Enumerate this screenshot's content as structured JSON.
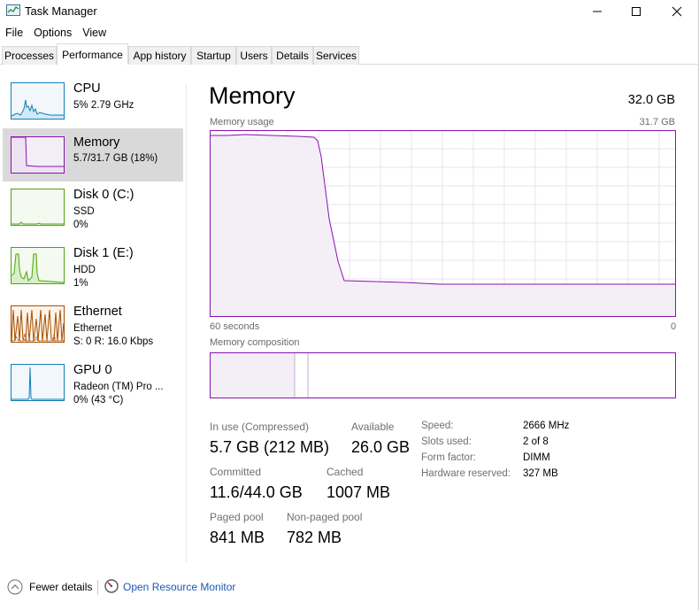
{
  "window": {
    "title": "Task Manager",
    "app_icon": "task-manager-icon",
    "controls": [
      "minimize-icon",
      "maximize-icon",
      "close-icon"
    ]
  },
  "menu": [
    "File",
    "Options",
    "View"
  ],
  "tabs": [
    "Processes",
    "Performance",
    "App history",
    "Startup",
    "Users",
    "Details",
    "Services"
  ],
  "active_tab": "Performance",
  "sidebar": [
    {
      "title": "CPU",
      "sub1": "5%  2.79 GHz",
      "sub2": "",
      "color": "#117dbb"
    },
    {
      "title": "Memory",
      "sub1": "5.7/31.7 GB (18%)",
      "sub2": "",
      "color": "#8b12ae"
    },
    {
      "title": "Disk 0 (C:)",
      "sub1": "SSD",
      "sub2": "0%",
      "color": "#4da60c"
    },
    {
      "title": "Disk 1 (E:)",
      "sub1": "HDD",
      "sub2": "1%",
      "color": "#4da60c"
    },
    {
      "title": "Ethernet",
      "sub1": "Ethernet",
      "sub2": "S: 0  R: 16.0 Kbps",
      "color": "#a74f01"
    },
    {
      "title": "GPU 0",
      "sub1": "Radeon (TM) Pro ...",
      "sub2": "0%  (43 °C)",
      "color": "#117dbb"
    }
  ],
  "main": {
    "title": "Memory",
    "total": "32.0 GB",
    "usage_label": "Memory usage",
    "usage_max": "31.7 GB",
    "time_left": "60 seconds",
    "time_right": "0",
    "composition_label": "Memory composition",
    "accent": "#8b12ae",
    "in_use_label": "In use (Compressed)",
    "in_use_value": "5.7 GB (212 MB)",
    "available_label": "Available",
    "available_value": "26.0 GB",
    "committed_label": "Committed",
    "committed_value": "11.6/44.0 GB",
    "cached_label": "Cached",
    "cached_value": "1007 MB",
    "paged_label": "Paged pool",
    "paged_value": "841 MB",
    "nonpaged_label": "Non-paged pool",
    "nonpaged_value": "782 MB",
    "details": [
      {
        "label": "Speed:",
        "value": "2666 MHz"
      },
      {
        "label": "Slots used:",
        "value": "2 of 8"
      },
      {
        "label": "Form factor:",
        "value": "DIMM"
      },
      {
        "label": "Hardware reserved:",
        "value": "327 MB"
      }
    ]
  },
  "footer": {
    "fewer_details": "Fewer details",
    "open_monitor": "Open Resource Monitor"
  }
}
